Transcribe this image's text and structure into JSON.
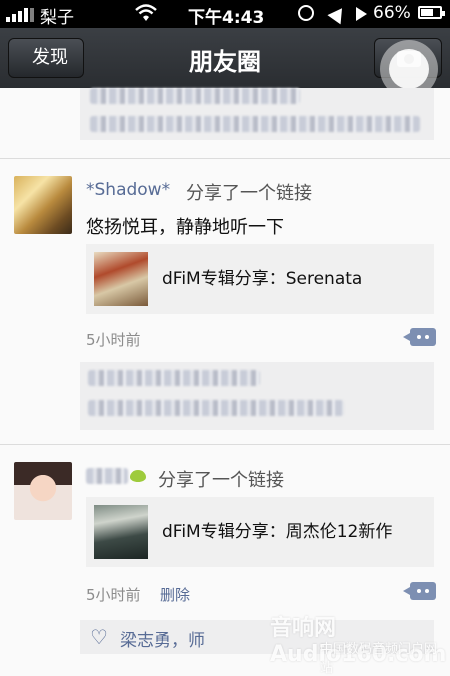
{
  "status_bar": {
    "carrier": "梨子",
    "time": "下午4:43",
    "battery_pct": "66%"
  },
  "nav": {
    "back_label": "发现",
    "title": "朋友圈"
  },
  "posts": [
    {
      "username": "*Shadow*",
      "action": "分享了一个链接",
      "text": "悠扬悦耳，静静地听一下",
      "link_title": "dFiM专辑分享：Serenata",
      "time": "5小时前"
    },
    {
      "action": "分享了一个链接",
      "link_title": "dFiM专辑分享：周杰伦12新作",
      "time": "5小时前",
      "delete_label": "删除",
      "likes": "梁志勇，师"
    }
  ],
  "watermark": {
    "line1": "音响网 Audio160.com",
    "line2": "中国数码音频门户网站"
  }
}
